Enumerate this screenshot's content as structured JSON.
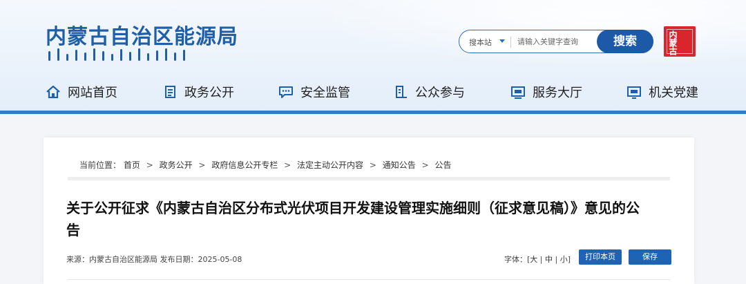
{
  "header": {
    "title": "内蒙古自治区能源局",
    "seal_text": "内蒙古"
  },
  "search": {
    "scope": "搜本站",
    "placeholder": "请输入关键字查询",
    "button": "搜索"
  },
  "nav": {
    "items": [
      {
        "label": "网站首页",
        "icon": "home-icon"
      },
      {
        "label": "政务公开",
        "icon": "document-icon"
      },
      {
        "label": "安全监管",
        "icon": "chat-icon"
      },
      {
        "label": "公众参与",
        "icon": "people-icon"
      },
      {
        "label": "服务大厅",
        "icon": "service-icon"
      },
      {
        "label": "机关党建",
        "icon": "party-icon"
      }
    ]
  },
  "breadcrumb": {
    "prefix": "当前位置：",
    "items": [
      "首页",
      "政务公开",
      "政府信息公开专栏",
      "法定主动公开内容",
      "通知公告",
      "公告"
    ],
    "separator": ">"
  },
  "article": {
    "title": "关于公开征求《内蒙古自治区分布式光伏项目开发建设管理实施细则（征求意见稿）》意见的公告",
    "meta": "来源：内蒙古自治区能源局 发布日期：2025-05-08"
  },
  "tools": {
    "font_label": "字体：[",
    "font_large": "大",
    "font_medium": "中",
    "font_small": "小",
    "font_end": "]",
    "divider": "|",
    "print": "打印本页",
    "save": "保存"
  },
  "colors": {
    "brand_blue": "#1f5fa8",
    "button_blue": "#1f63b5",
    "seal_red": "#d9262c"
  }
}
